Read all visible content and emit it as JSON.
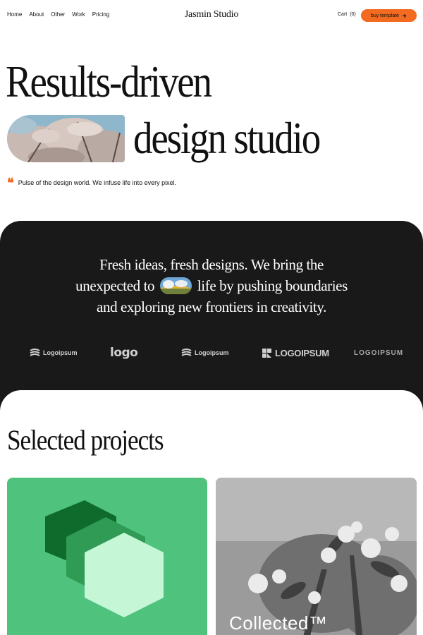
{
  "nav": {
    "links": [
      "Home",
      "About",
      "Other",
      "Work",
      "Pricing"
    ],
    "brand": "Jasmin Studio",
    "cart_label": "Cart",
    "cart_count": "(0)",
    "buy_label": "buy template",
    "buy_icon": "arrow-right-icon"
  },
  "hero": {
    "line1": "Results-driven",
    "line2": "design studio",
    "quote": "Pulse of the design world. We infuse life into every pixel."
  },
  "statement": {
    "line1": "Fresh ideas, fresh designs. We bring the",
    "line2_before": "unexpected to",
    "line2_after": "life by pushing boundaries",
    "line3": "and exploring new frontiers in creativity."
  },
  "logos": [
    "Logoipsum",
    "logo",
    "Logoipsum",
    "LOGOIPSUM",
    "LOGOIPSUM"
  ],
  "projects": {
    "title": "Selected projects",
    "card2_label": "Collected™"
  },
  "colors": {
    "accent": "#f26b21",
    "dark": "#1a1919",
    "card_green": "#4fc37d"
  }
}
